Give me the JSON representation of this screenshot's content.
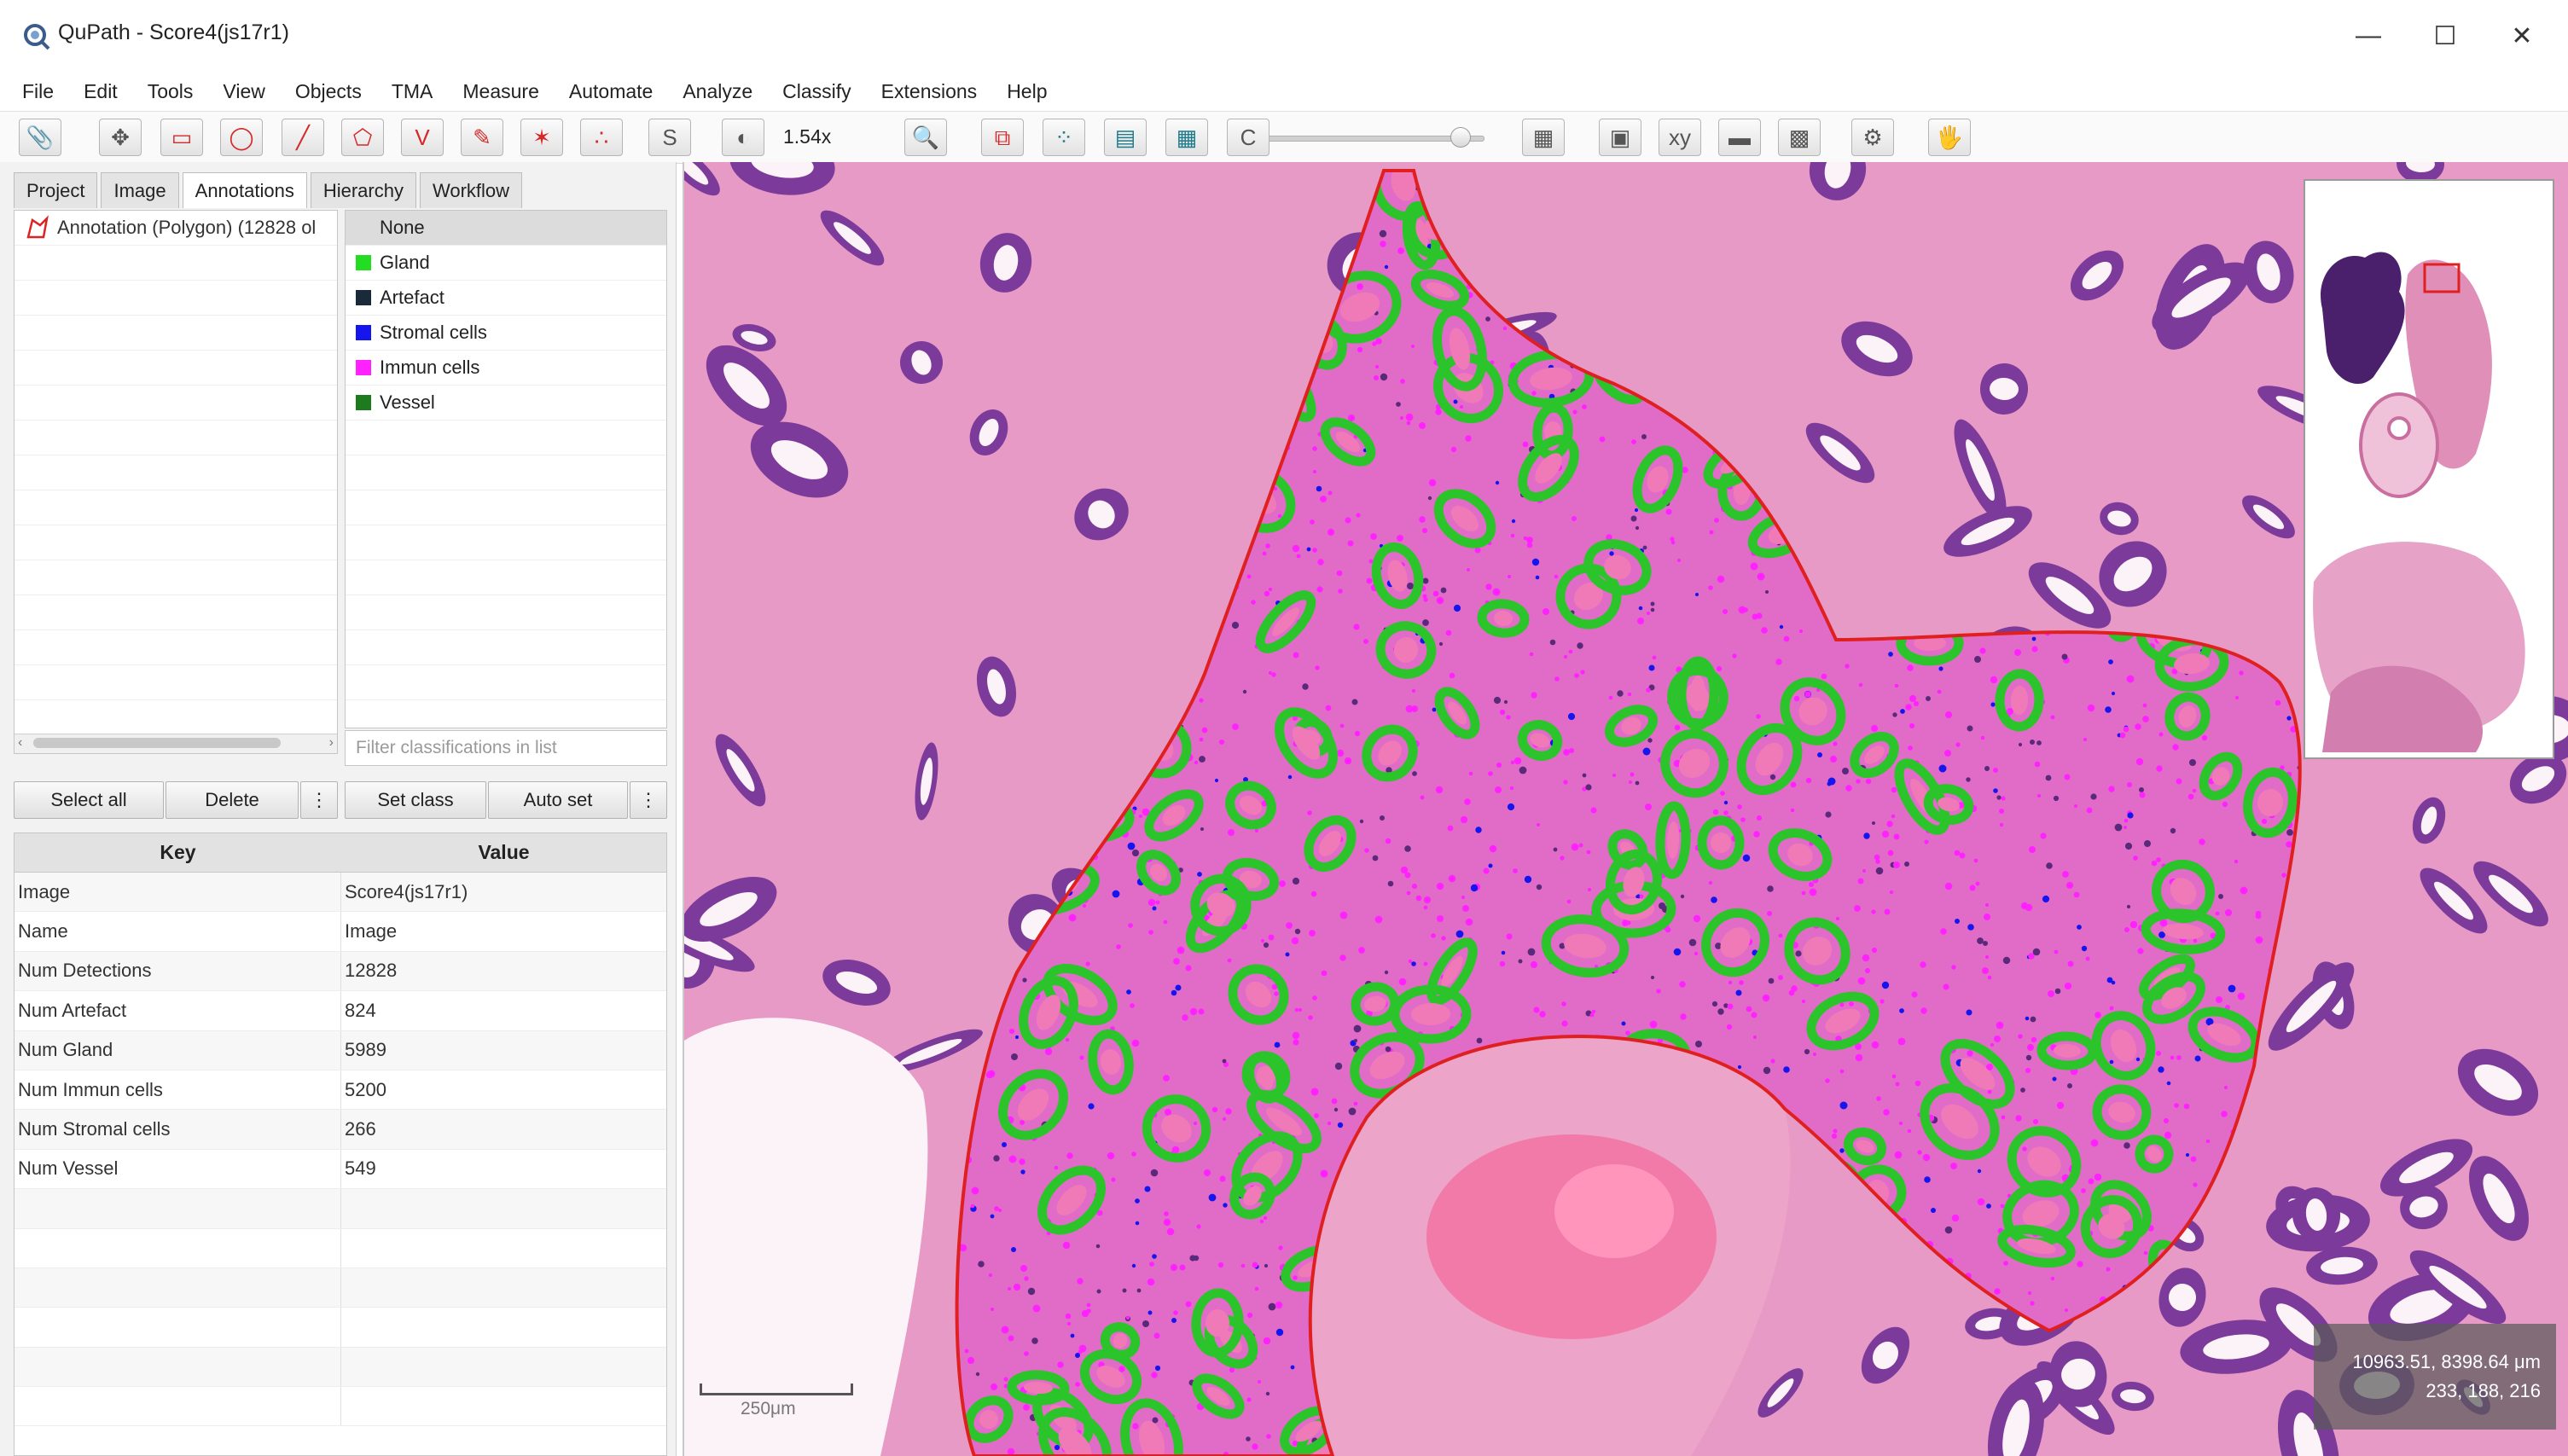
{
  "window": {
    "title": "QuPath - Score4(js17r1)",
    "controls": [
      "—",
      "☐",
      "✕"
    ]
  },
  "menu": [
    "File",
    "Edit",
    "Tools",
    "View",
    "Objects",
    "TMA",
    "Measure",
    "Automate",
    "Analyze",
    "Classify",
    "Extensions",
    "Help"
  ],
  "toolbar": {
    "zoom": "1.54x",
    "opacity_slider_value": 0.9,
    "tools": [
      {
        "name": "pin-tool",
        "glyph": "📎"
      },
      {
        "name": "move-tool",
        "glyph": "✥"
      },
      {
        "name": "rectangle-tool",
        "glyph": "▭"
      },
      {
        "name": "ellipse-tool",
        "glyph": "◯"
      },
      {
        "name": "line-tool",
        "glyph": "╱"
      },
      {
        "name": "polygon-tool",
        "glyph": "⬠"
      },
      {
        "name": "polyline-tool",
        "glyph": "V"
      },
      {
        "name": "brush-tool",
        "glyph": "✎"
      },
      {
        "name": "wand-tool",
        "glyph": "✶"
      },
      {
        "name": "points-tool",
        "glyph": "∴"
      },
      {
        "name": "selection-mode",
        "glyph": "S"
      },
      {
        "name": "brightness-contrast",
        "glyph": "◐"
      },
      {
        "name": "zoom-to-fit",
        "glyph": "🔍"
      },
      {
        "name": "show-annotations",
        "glyph": "⧉"
      },
      {
        "name": "show-tma-grid",
        "glyph": "⁘"
      },
      {
        "name": "show-detections",
        "glyph": "▤"
      },
      {
        "name": "fill-detections",
        "glyph": "▦"
      },
      {
        "name": "show-connections",
        "glyph": "C"
      },
      {
        "name": "show-grid",
        "glyph": "▦"
      },
      {
        "name": "show-overview",
        "glyph": "▣"
      },
      {
        "name": "show-cursor-location",
        "glyph": "xy"
      },
      {
        "name": "show-scalebar",
        "glyph": "▬"
      },
      {
        "name": "show-counting-grid",
        "glyph": "▩"
      },
      {
        "name": "settings",
        "glyph": "⚙"
      },
      {
        "name": "measurement-map",
        "glyph": "🖐"
      }
    ]
  },
  "tabs": [
    "Project",
    "Image",
    "Annotations",
    "Hierarchy",
    "Workflow"
  ],
  "active_tab": "Annotations",
  "annotations": [
    {
      "label": "Annotation (Polygon) (12828 ol"
    }
  ],
  "classifications": {
    "header": "None",
    "items": [
      {
        "name": "Gland",
        "color": "#22dd22"
      },
      {
        "name": "Artefact",
        "color": "#1a2a3a"
      },
      {
        "name": "Stromal cells",
        "color": "#1515ee"
      },
      {
        "name": "Immun cells",
        "color": "#ff22ff"
      },
      {
        "name": "Vessel",
        "color": "#1d7a1d"
      }
    ],
    "filter_placeholder": "Filter classifications in list"
  },
  "buttons": {
    "select_all": "Select all",
    "delete": "Delete",
    "more1": "⋮",
    "set_class": "Set class",
    "auto_set": "Auto set",
    "more2": "⋮"
  },
  "measurements": {
    "key_header": "Key",
    "value_header": "Value",
    "rows": [
      {
        "key": "Image",
        "value": "Score4(js17r1)"
      },
      {
        "key": "Name",
        "value": "Image"
      },
      {
        "key": "Num Detections",
        "value": "12828"
      },
      {
        "key": "Num Artefact",
        "value": "824"
      },
      {
        "key": "Num Gland",
        "value": "5989"
      },
      {
        "key": "Num Immun cells",
        "value": "5200"
      },
      {
        "key": "Num Stromal cells",
        "value": "266"
      },
      {
        "key": "Num Vessel",
        "value": "549"
      }
    ]
  },
  "viewer": {
    "cursor_location": "10963.51, 8398.64 μm",
    "pixel_rgb": "233, 188, 216",
    "scalebar_label": "250μm",
    "colors": {
      "tissue_bg": "#f1d6e3",
      "stroma": "#e79ac5",
      "gland_epithelium": "#7c3a9a",
      "lumen": "#fbf3f8",
      "annotation_outline": "#e02020",
      "gland_detection": "#2bc42b",
      "immune_cells": "#ff22ff",
      "stromal_cells": "#1515ee"
    }
  }
}
